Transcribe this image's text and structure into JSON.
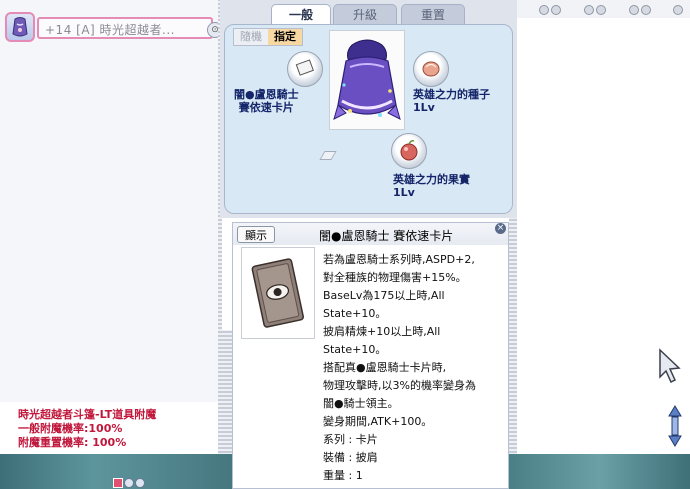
{
  "equipment_slot": {
    "item_name": "+14 [A] 時光超越者...",
    "badge_icon": "lock-icon"
  },
  "tabs": [
    {
      "label": "一般"
    },
    {
      "label": "升級"
    },
    {
      "label": "重置"
    }
  ],
  "mode_toggle": {
    "random": "隨機",
    "assign": "指定"
  },
  "enchant_nodes": {
    "card": {
      "line1": "闇●盧恩騎士",
      "line2": "賽依速卡片"
    },
    "seed": {
      "line1": "英雄之力的種子",
      "line2": "1Lv"
    },
    "fruit": {
      "line1": "英雄之力的果實",
      "line2": "1Lv"
    }
  },
  "info_window": {
    "show_button": "顯示",
    "title": "闇●盧恩騎士 賽依速卡片",
    "close_icon": "close-icon",
    "lines": [
      "若為盧恩騎士系列時,ASPD+2,",
      "對全種族的物理傷害+15%。",
      "BaseLv為175以上時,All",
      "State+10。",
      "披肩精煉+10以上時,All",
      "State+10。",
      "搭配真●盧恩騎士卡片時,",
      "物理攻擊時,以3%的機率變身為",
      "闇●騎士領主。",
      "變身期間,ATK+100。",
      "系列 : 卡片",
      "裝備 : 披肩",
      "重量 : 1"
    ]
  },
  "enchant_info": {
    "line1": "時光超越者斗篷-LT道具附魔",
    "line2": "一般附魔機率:100%",
    "line3": "附魔重置機率: 100%"
  },
  "colors": {
    "accent_pink": "#e48bb6",
    "info_red": "#c0173b",
    "node_label": "#14256a",
    "panel_bg": "#d8e8f5"
  }
}
